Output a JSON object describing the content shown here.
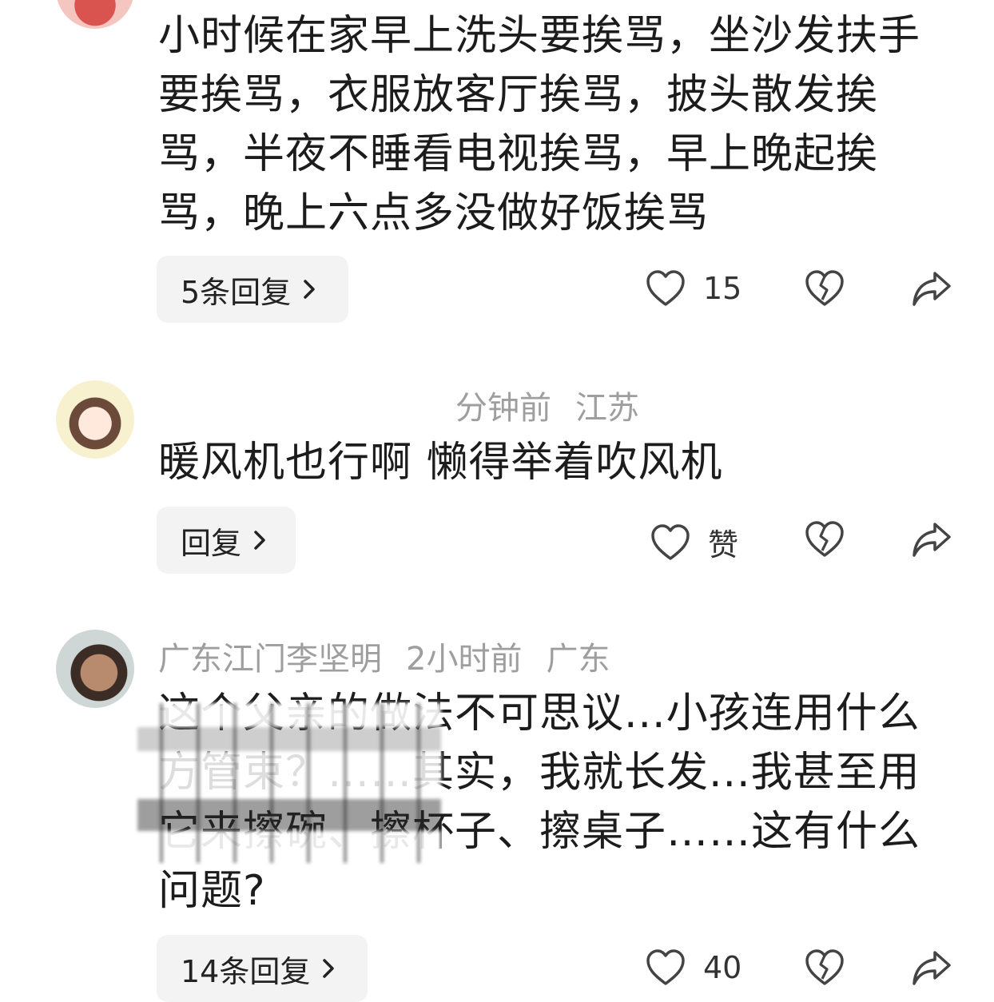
{
  "comments": [
    {
      "text": "小时候在家早上洗头要挨骂，坐沙发扶手要挨骂，衣服放客厅挨骂，披头散发挨骂，半夜不睡看电视挨骂，早上晚起挨骂，晚上六点多没做好饭挨骂",
      "reply_label": "5条回复",
      "like_count": "15"
    },
    {
      "time": "分钟前",
      "location": "江苏",
      "text": "暖风机也行啊 懒得举着吹风机",
      "reply_label": "回复",
      "like_label": "赞"
    },
    {
      "username": "广东江门李坚明",
      "time": "2小时前",
      "location": "广东",
      "text": "这个父亲的做法不可思议...小孩连用什么方管束？……其实，我就长发...我甚至用它来擦碗、擦杯子、擦桌子……这有什么问题?",
      "reply_label": "14条回复",
      "like_count": "40"
    }
  ],
  "icons": {
    "like": "heart-outline-icon",
    "dislike": "broken-heart-icon",
    "share": "share-arrow-icon",
    "chevron": "chevron-right-icon"
  }
}
